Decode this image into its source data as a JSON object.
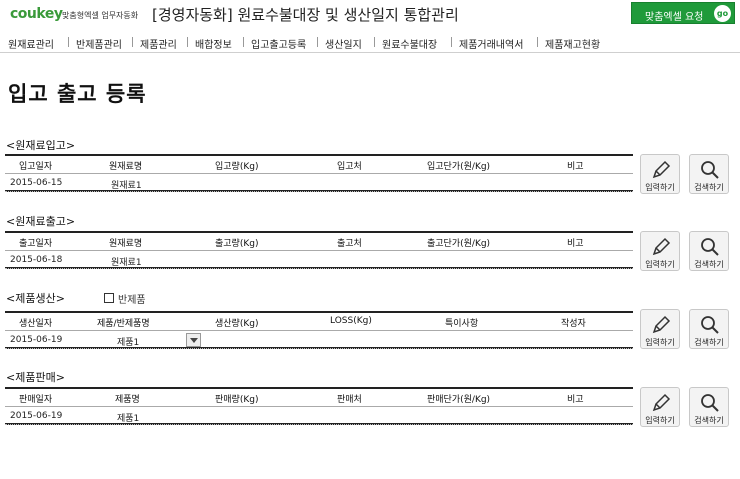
{
  "brand": {
    "logo": "coukey",
    "tagline": "맞춤형엑셀 업무자동화"
  },
  "app_title": "[경영자동화] 원료수불대장 및 생산일지 통합관리",
  "request_button": {
    "label": "맞춤엑셀 요청",
    "badge": "go"
  },
  "nav": [
    "원재료관리",
    "반제품관리",
    "제품관리",
    "배합정보",
    "입고출고등록",
    "생산일지",
    "원료수불대장",
    "제품거래내역서",
    "제품재고현황"
  ],
  "page_title": "입고 출고 등록",
  "actions": {
    "input_label": "입력하기",
    "search_label": "검색하기"
  },
  "sections": [
    {
      "title": "<원재료입고>",
      "headers": [
        "입고일자",
        "원재료명",
        "입고량(Kg)",
        "입고처",
        "입고단가(원/Kg)",
        "비고"
      ],
      "row": [
        "2015-06-15",
        "원재료1",
        "",
        "",
        "",
        ""
      ]
    },
    {
      "title": "<원재료출고>",
      "headers": [
        "출고일자",
        "원재료명",
        "출고량(Kg)",
        "출고처",
        "출고단가(원/Kg)",
        "비고"
      ],
      "row": [
        "2015-06-18",
        "원재료1",
        "",
        "",
        "",
        ""
      ]
    },
    {
      "title": "<제품생산>",
      "checkbox_label": "반제품",
      "headers": [
        "생산일자",
        "제품/반제품명",
        "생산량(Kg)",
        "LOSS(Kg)",
        "특이사항",
        "작성자"
      ],
      "row": [
        "2015-06-19",
        "제품1",
        "",
        "",
        "",
        ""
      ]
    },
    {
      "title": "<제품판매>",
      "headers": [
        "판매일자",
        "제품명",
        "판매량(Kg)",
        "판매처",
        "판매단가(원/Kg)",
        "비고"
      ],
      "row": [
        "2015-06-19",
        "제품1",
        "",
        "",
        "",
        ""
      ]
    }
  ]
}
